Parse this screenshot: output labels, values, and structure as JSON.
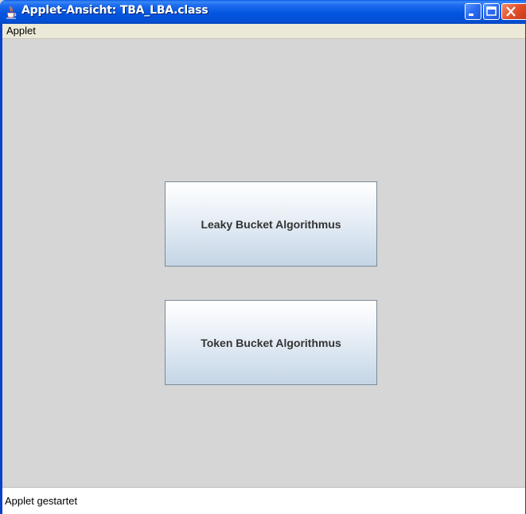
{
  "window": {
    "title": "Applet-Ansicht: TBA_LBA.class",
    "app_icon": "java-cup-icon",
    "controls": {
      "minimize_icon": "minimize-icon",
      "maximize_icon": "maximize-icon",
      "close_icon": "close-icon"
    },
    "colors": {
      "titlebar": "#0455e0",
      "content_background": "#d6d6d6",
      "close_button": "#e2502a"
    }
  },
  "menubar": {
    "items": [
      {
        "label": "Applet"
      }
    ]
  },
  "main": {
    "buttons": [
      {
        "label": "Leaky Bucket Algorithmus"
      },
      {
        "label": "Token Bucket Algorithmus"
      }
    ]
  },
  "statusbar": {
    "text": "Applet gestartet"
  }
}
